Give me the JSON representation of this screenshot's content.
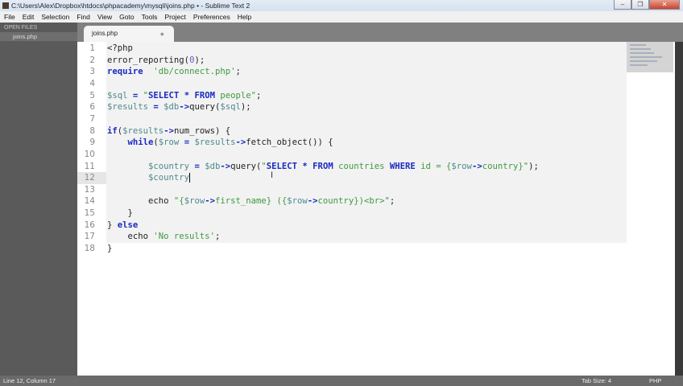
{
  "window": {
    "title": "C:\\Users\\Alex\\Dropbox\\htdocs\\phpacademy\\mysqli\\joins.php • - Sublime Text 2",
    "min": "–",
    "max": "❐",
    "close": "✕"
  },
  "menu": [
    "File",
    "Edit",
    "Selection",
    "Find",
    "View",
    "Goto",
    "Tools",
    "Project",
    "Preferences",
    "Help"
  ],
  "sidebar": {
    "header": "OPEN FILES",
    "files": [
      "joins.php"
    ]
  },
  "tab": {
    "label": "joins.php",
    "dirty_marker": "●"
  },
  "code": [
    [
      [
        "",
        "<?php"
      ]
    ],
    [
      [
        "fn",
        "error_reporting("
      ],
      [
        "num",
        "0"
      ],
      [
        "fn",
        ");"
      ]
    ],
    [
      [
        "kw",
        "require"
      ],
      [
        "",
        "  "
      ],
      [
        "str",
        "'db/connect.php'"
      ],
      [
        "",
        ";"
      ]
    ],
    [],
    [
      [
        "var",
        "$sql"
      ],
      [
        "op",
        " = "
      ],
      [
        "q",
        "\""
      ],
      [
        "kw",
        "SELECT * FROM"
      ],
      [
        "str",
        " people\""
      ],
      [
        "",
        ";"
      ]
    ],
    [
      [
        "var",
        "$results"
      ],
      [
        "op",
        " = "
      ],
      [
        "var",
        "$db"
      ],
      [
        "op",
        "->"
      ],
      [
        "",
        "query("
      ],
      [
        "var",
        "$sql"
      ],
      [
        "",
        ");"
      ]
    ],
    [],
    [
      [
        "kw",
        "if"
      ],
      [
        "",
        "("
      ],
      [
        "var",
        "$results"
      ],
      [
        "op",
        "->"
      ],
      [
        "",
        "num_rows) {"
      ]
    ],
    [
      [
        "",
        "    "
      ],
      [
        "kw",
        "while"
      ],
      [
        "",
        "("
      ],
      [
        "var",
        "$row"
      ],
      [
        "op",
        " = "
      ],
      [
        "var",
        "$results"
      ],
      [
        "op",
        "->"
      ],
      [
        "",
        "fetch_object()) {"
      ]
    ],
    [],
    [
      [
        "",
        "        "
      ],
      [
        "var",
        "$country"
      ],
      [
        "op",
        " = "
      ],
      [
        "var",
        "$db"
      ],
      [
        "op",
        "->"
      ],
      [
        "",
        "query("
      ],
      [
        "q",
        "\""
      ],
      [
        "kw",
        "SELECT * FROM"
      ],
      [
        "str",
        " countries "
      ],
      [
        "kw",
        "WHERE"
      ],
      [
        "str",
        " id = {"
      ],
      [
        "var",
        "$row"
      ],
      [
        "op",
        "->"
      ],
      [
        "str",
        "country}\""
      ],
      [
        "",
        ");"
      ]
    ],
    [
      [
        "",
        "        "
      ],
      [
        "var",
        "$country"
      ]
    ],
    [],
    [
      [
        "",
        "        echo "
      ],
      [
        "str",
        "\"{"
      ],
      [
        "var",
        "$row"
      ],
      [
        "op",
        "->"
      ],
      [
        "str",
        "first_name} ({"
      ],
      [
        "var",
        "$row"
      ],
      [
        "op",
        "->"
      ],
      [
        "str",
        "country})<br>\""
      ],
      [
        "",
        ";"
      ]
    ],
    [
      [
        "",
        "    }"
      ]
    ],
    [
      [
        "",
        "} "
      ],
      [
        "kw",
        "else"
      ],
      [
        "",
        "",
        " {"
      ],
      [
        "",
        ""
      ]
    ],
    [
      [
        "",
        "    echo "
      ],
      [
        "str",
        "'No results'"
      ],
      [
        "",
        ";"
      ]
    ],
    [
      [
        "",
        "}"
      ]
    ]
  ],
  "status": {
    "position": "Line 12, Column 17",
    "tab_size": "Tab Size: 4",
    "syntax": "PHP"
  }
}
